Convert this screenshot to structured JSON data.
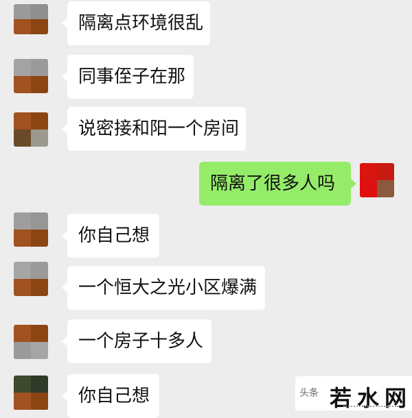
{
  "messages": [
    {
      "side": "in",
      "text": "隔离点环境很乱"
    },
    {
      "side": "in",
      "text": "同事侄子在那"
    },
    {
      "side": "in",
      "text": "说密接和阳一个房间"
    },
    {
      "side": "out",
      "text": "隔离了很多人吗"
    },
    {
      "side": "in",
      "text": "你自己想"
    },
    {
      "side": "in",
      "text": "一个恒大之光小区爆满"
    },
    {
      "side": "in",
      "text": "一个房子十多人"
    },
    {
      "side": "in",
      "text": "你自己想"
    }
  ],
  "watermark": {
    "small": "头条",
    "main": "若水网"
  },
  "colors": {
    "background": "#ededed",
    "incoming_bubble": "#ffffff",
    "outgoing_bubble": "#95ec69"
  }
}
